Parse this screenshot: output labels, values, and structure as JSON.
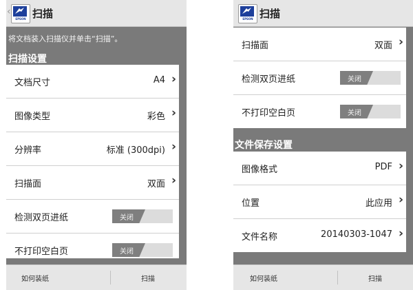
{
  "colors": {
    "epson_blue": "#1d3f9b",
    "toggle_off": "#7f7f7f",
    "panel_bg": "#7a7a7a"
  },
  "left": {
    "title": "扫描",
    "logo_text": "EPSON",
    "hint": "将文档装入扫描仪并单击“扫描”。",
    "section_scan": "扫描设置",
    "rows": [
      {
        "label": "文档尺寸",
        "value": "A4"
      },
      {
        "label": "图像类型",
        "value": "彩色"
      },
      {
        "label": "分辨率",
        "value": "标准 (300dpi)"
      },
      {
        "label": "扫描面",
        "value": "双面"
      },
      {
        "label": "检测双页进纸",
        "toggle": "关闭"
      },
      {
        "label": "不打印空白页",
        "toggle": "关闭"
      }
    ],
    "bottom": {
      "left": "如何装纸",
      "right": "扫描"
    }
  },
  "right": {
    "title": "扫描",
    "logo_text": "EPSON",
    "rows_scan": [
      {
        "label": "扫描面",
        "value": "双面"
      },
      {
        "label": "检测双页进纸",
        "toggle": "关闭"
      },
      {
        "label": "不打印空白页",
        "toggle": "关闭"
      }
    ],
    "section_file": "文件保存设置",
    "rows_file": [
      {
        "label": "图像格式",
        "value": "PDF"
      },
      {
        "label": "位置",
        "value": "此应用"
      },
      {
        "label": "文件名称",
        "value": "20140303-1047"
      }
    ],
    "bottom": {
      "left": "如何装纸",
      "right": "扫描"
    }
  }
}
